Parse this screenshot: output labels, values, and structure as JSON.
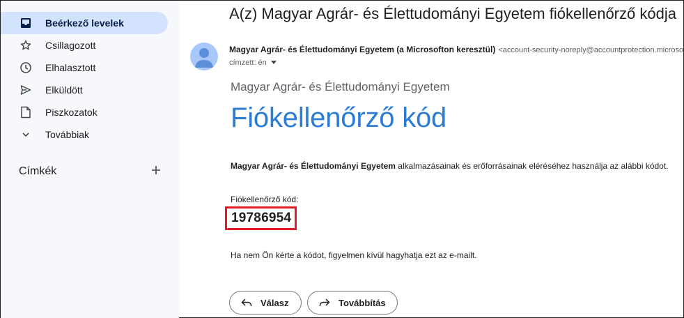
{
  "sidebar": {
    "items": [
      {
        "label": "Beérkező levelek",
        "icon": "inbox-icon",
        "active": true
      },
      {
        "label": "Csillagozott",
        "icon": "star-icon",
        "active": false
      },
      {
        "label": "Elhalasztott",
        "icon": "clock-icon",
        "active": false
      },
      {
        "label": "Elküldött",
        "icon": "send-icon",
        "active": false
      },
      {
        "label": "Piszkozatok",
        "icon": "draft-icon",
        "active": false
      },
      {
        "label": "Továbbiak",
        "icon": "chevron-down-icon",
        "active": false
      }
    ],
    "labels_header": "Címkék"
  },
  "email": {
    "subject": "A(z) Magyar Agrár- és Élettudományi Egyetem fiókellenőrző kódja",
    "sender_name": "Magyar Agrár- és Élettudományi Egyetem (a Microsofton keresztül)",
    "sender_email": "<account-security-noreply@accountprotection.microsoft.com>",
    "recipient": "címzett: én",
    "org_title": "Magyar Agrár- és Élettudományi Egyetem",
    "big_title": "Fiókellenőrző kód",
    "body_org": "Magyar Agrár- és Élettudományi Egyetem",
    "body_text": " alkalmazásainak és erőforrásainak eléréséhez használja az alábbi kódot.",
    "code_label": "Fiókellenőrző kód:",
    "code_value": "19786954",
    "ignore_text": "Ha nem Ön kérte a kódot, figyelmen kívül hagyhatja ezt az e-mailt."
  },
  "actions": {
    "reply_label": "Válasz",
    "forward_label": "Továbbítás"
  },
  "colors": {
    "accent_title": "#2b7cd3",
    "active_nav": "#d3e3fd",
    "highlight_box": "#e01b24",
    "avatar": "#a8c7fa"
  }
}
